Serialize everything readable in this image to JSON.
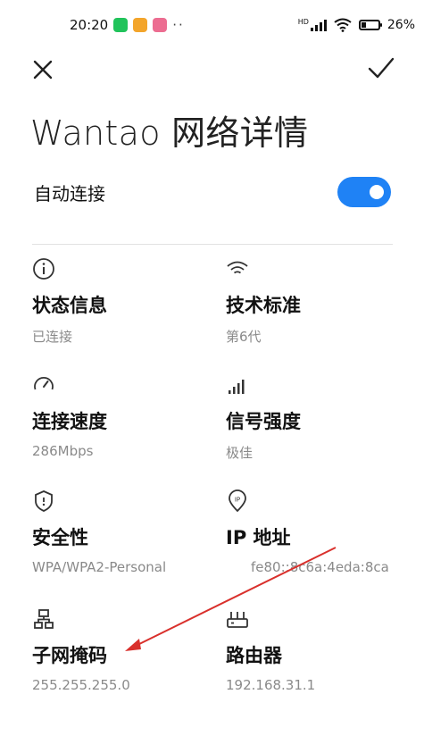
{
  "status_bar": {
    "time": "20:20",
    "app_icons": [
      "chat-app-icon",
      "notes-app-icon",
      "gallery-app-icon"
    ],
    "more": "··",
    "hd_label": "HD",
    "battery_percent": "26%",
    "battery_level": 0.26
  },
  "header": {
    "close_icon": "close-icon",
    "confirm_icon": "check-icon"
  },
  "title": "Wantao 网络详情",
  "auto_connect": {
    "label": "自动连接",
    "enabled": true
  },
  "details": [
    {
      "icon": "info-icon",
      "label": "状态信息",
      "value": "已连接"
    },
    {
      "icon": "wifi-icon",
      "label": "技术标准",
      "value": "第6代"
    },
    {
      "icon": "speedometer-icon",
      "label": "连接速度",
      "value": "286Mbps"
    },
    {
      "icon": "signal-strength-icon",
      "label": "信号强度",
      "value": "极佳"
    },
    {
      "icon": "shield-icon",
      "label": "安全性",
      "value": "WPA/WPA2-Personal"
    },
    {
      "icon": "ip-location-icon",
      "label": "IP 地址",
      "value": "fe80::8c6a:4eda:8ca"
    },
    {
      "icon": "network-topology-icon",
      "label": "子网掩码",
      "value": "255.255.255.0"
    },
    {
      "icon": "router-icon",
      "label": "路由器",
      "value": "192.168.31.1"
    }
  ],
  "colors": {
    "accent": "#1f82f5",
    "annotation_arrow": "#d9302c",
    "secondary_text": "#8a8a8a"
  }
}
